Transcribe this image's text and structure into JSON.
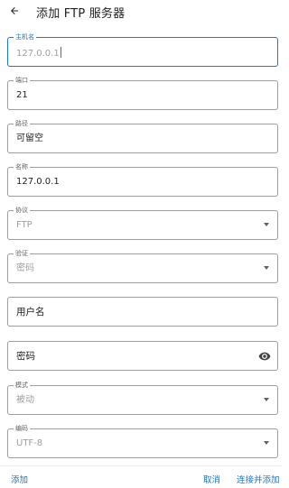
{
  "header": {
    "title": "添加 FTP 服务器"
  },
  "form": {
    "host": {
      "label": "主机名",
      "value": "127.0.0.1"
    },
    "port": {
      "label": "端口",
      "value": "21"
    },
    "path": {
      "label": "路径",
      "value": "可留空"
    },
    "name": {
      "label": "名称",
      "value": "127.0.0.1"
    },
    "protocol": {
      "label": "协议",
      "value": "FTP"
    },
    "auth": {
      "label": "验证",
      "value": "密码"
    },
    "username": {
      "placeholder": "用户名"
    },
    "password": {
      "placeholder": "密码"
    },
    "mode": {
      "label": "模式",
      "value": "被动"
    },
    "encoding": {
      "label": "编码",
      "value": "UTF-8"
    }
  },
  "footer": {
    "add_label": "添加",
    "cancel_label": "取消",
    "connect_add_label": "连接并添加"
  },
  "colors": {
    "accent": "#1976d2",
    "border": "#9e9e9e",
    "muted": "#9e9e9e"
  }
}
